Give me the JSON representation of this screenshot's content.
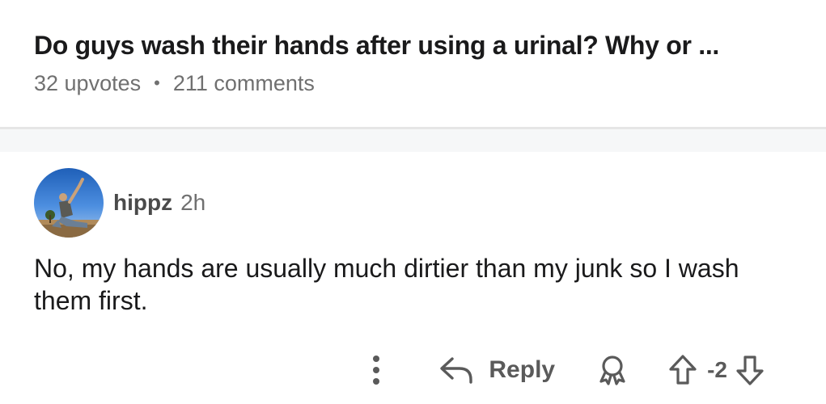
{
  "post": {
    "title": "Do guys wash their hands after using a urinal? Why or ...",
    "upvotes": "32 upvotes",
    "separator": "•",
    "comments": "211 comments"
  },
  "comment": {
    "author": "hippz",
    "time": "2h",
    "body": "No, my hands are usually much dirtier than my junk so I wash them first.",
    "actions": {
      "more_icon": "vertical-ellipsis-icon",
      "reply_icon": "reply-arrow-icon",
      "reply_label": "Reply",
      "award_icon": "award-icon",
      "upvote_icon": "upvote-arrow-icon",
      "score": "-2",
      "downvote_icon": "downvote-arrow-icon"
    }
  },
  "colors": {
    "text_primary": "#1a1a1b",
    "text_secondary": "#707070",
    "action_gray": "#5a5a5a",
    "divider": "#e6e6e6",
    "band": "#f6f7f8"
  }
}
